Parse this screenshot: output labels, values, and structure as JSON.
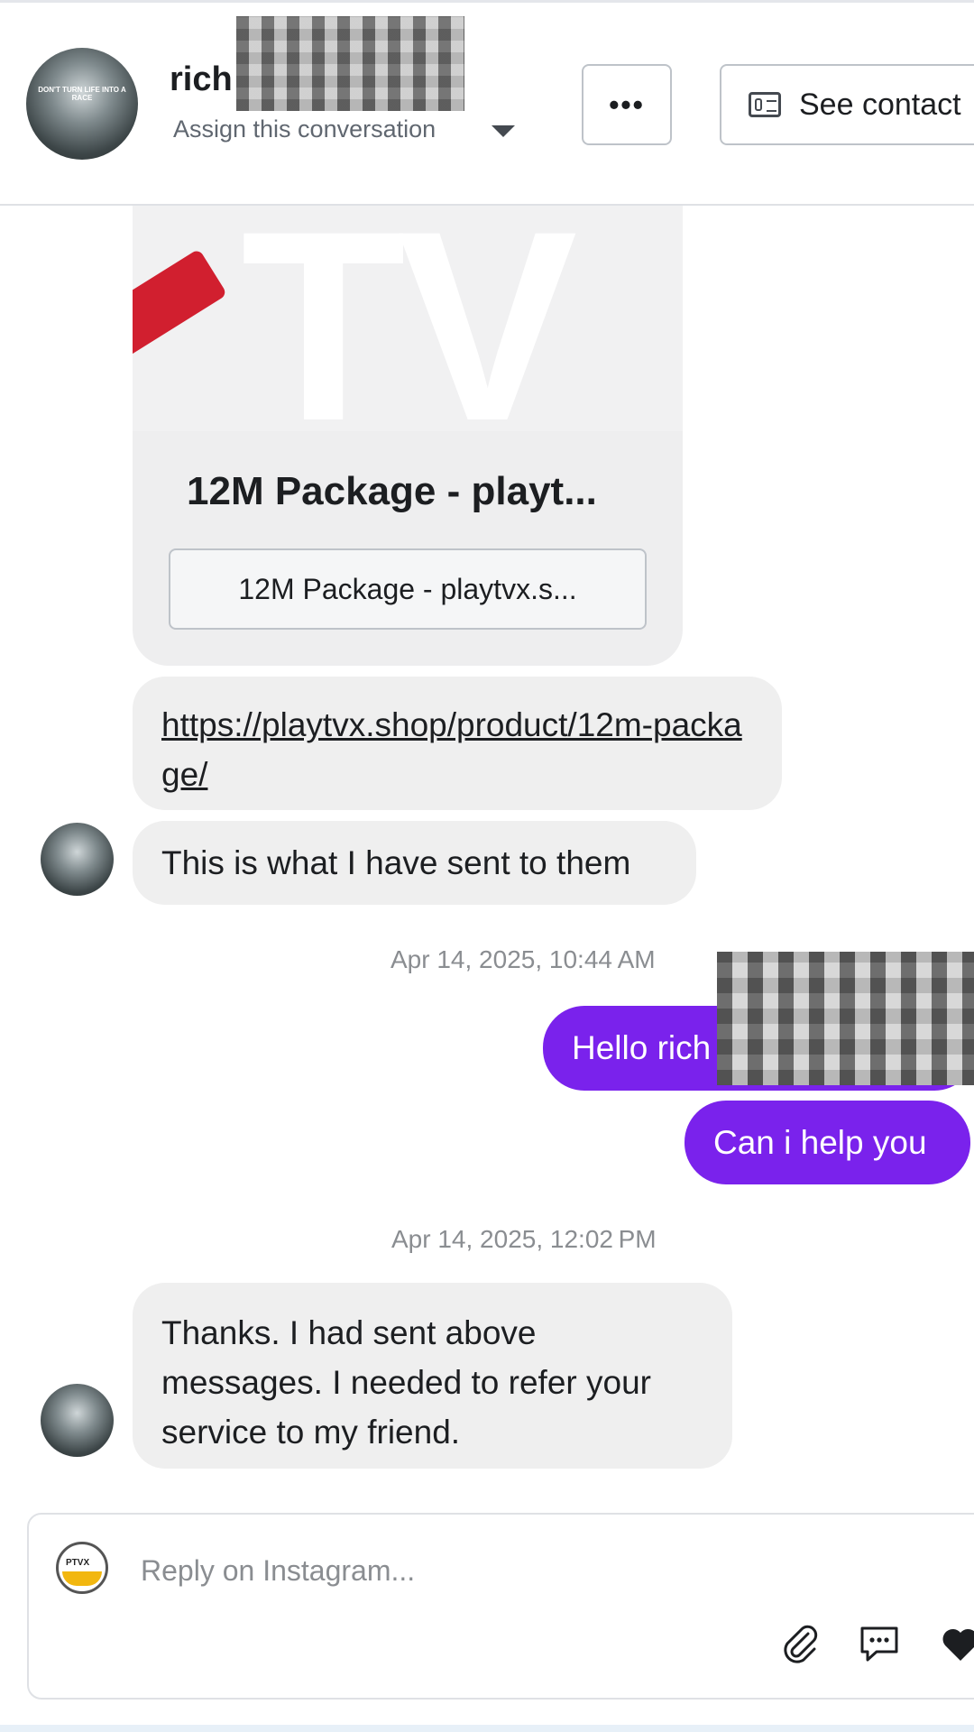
{
  "header": {
    "contact_name": "rich",
    "assign_label": "Assign this conversation",
    "more_label": "•••",
    "see_contact_label": "See contact"
  },
  "avatar_caption": "DON'T TURN LIFE INTO A RACE",
  "messages": {
    "product_title": "12M Package - playt...",
    "product_button": "12M Package - playtvx.s...",
    "link_text": "https://playtvx.shop/product/12m-package/",
    "incoming_1": "This is what I have sent to them",
    "timestamp_1": "Apr 14, 2025, 10:44 AM",
    "outgoing_1": "Hello rich",
    "outgoing_2": "Can i help you",
    "timestamp_2": "Apr 14, 2025, 12:02 PM",
    "incoming_2": "Thanks. I had sent above messages. I needed to refer your service to my friend."
  },
  "composer": {
    "placeholder": "Reply on Instagram...",
    "logo_text": "PTVX"
  },
  "icons": [
    "contact-card-icon",
    "chevron-down-icon",
    "attachment-icon",
    "saved-reply-icon",
    "heart-icon"
  ],
  "colors": {
    "outgoing_bubble": "#7a22ec",
    "incoming_bubble": "#efefef"
  }
}
